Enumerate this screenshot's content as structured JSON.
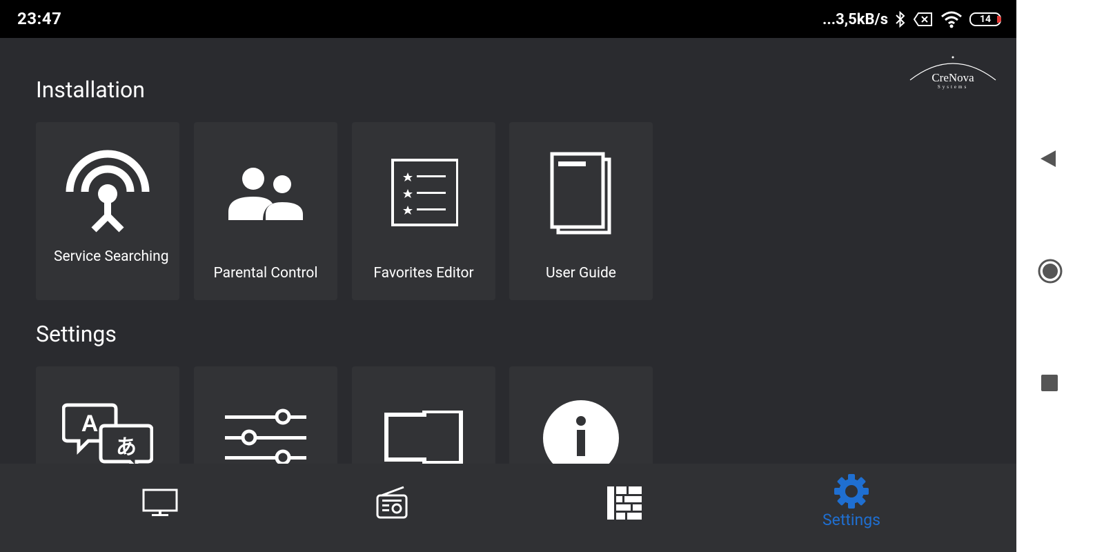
{
  "status": {
    "time": "23:47",
    "net_speed": "...3,5kB/s",
    "battery": "14"
  },
  "logo": {
    "name": "CreNova",
    "sub": "Systems"
  },
  "installation": {
    "title": "Installation",
    "tiles": [
      {
        "label": "Service Searching",
        "icon": "antenna-icon"
      },
      {
        "label": "Parental Control",
        "icon": "users-icon"
      },
      {
        "label": "Favorites Editor",
        "icon": "star-list-icon"
      },
      {
        "label": "User Guide",
        "icon": "document-icon"
      }
    ]
  },
  "settings_section": {
    "title": "Settings",
    "tiles": [
      {
        "icon": "language-icon"
      },
      {
        "icon": "sliders-icon"
      },
      {
        "icon": "screen-format-icon"
      },
      {
        "icon": "info-icon"
      }
    ]
  },
  "bottom_nav": {
    "items": [
      {
        "icon": "tv-icon",
        "label": ""
      },
      {
        "icon": "radio-icon",
        "label": ""
      },
      {
        "icon": "guide-grid-icon",
        "label": ""
      },
      {
        "icon": "gear-icon",
        "label": "Settings",
        "active": true
      }
    ],
    "active_color": "#1f6fd1"
  },
  "system_nav": {
    "back": "back-icon",
    "home": "home-icon",
    "recents": "recents-icon"
  }
}
